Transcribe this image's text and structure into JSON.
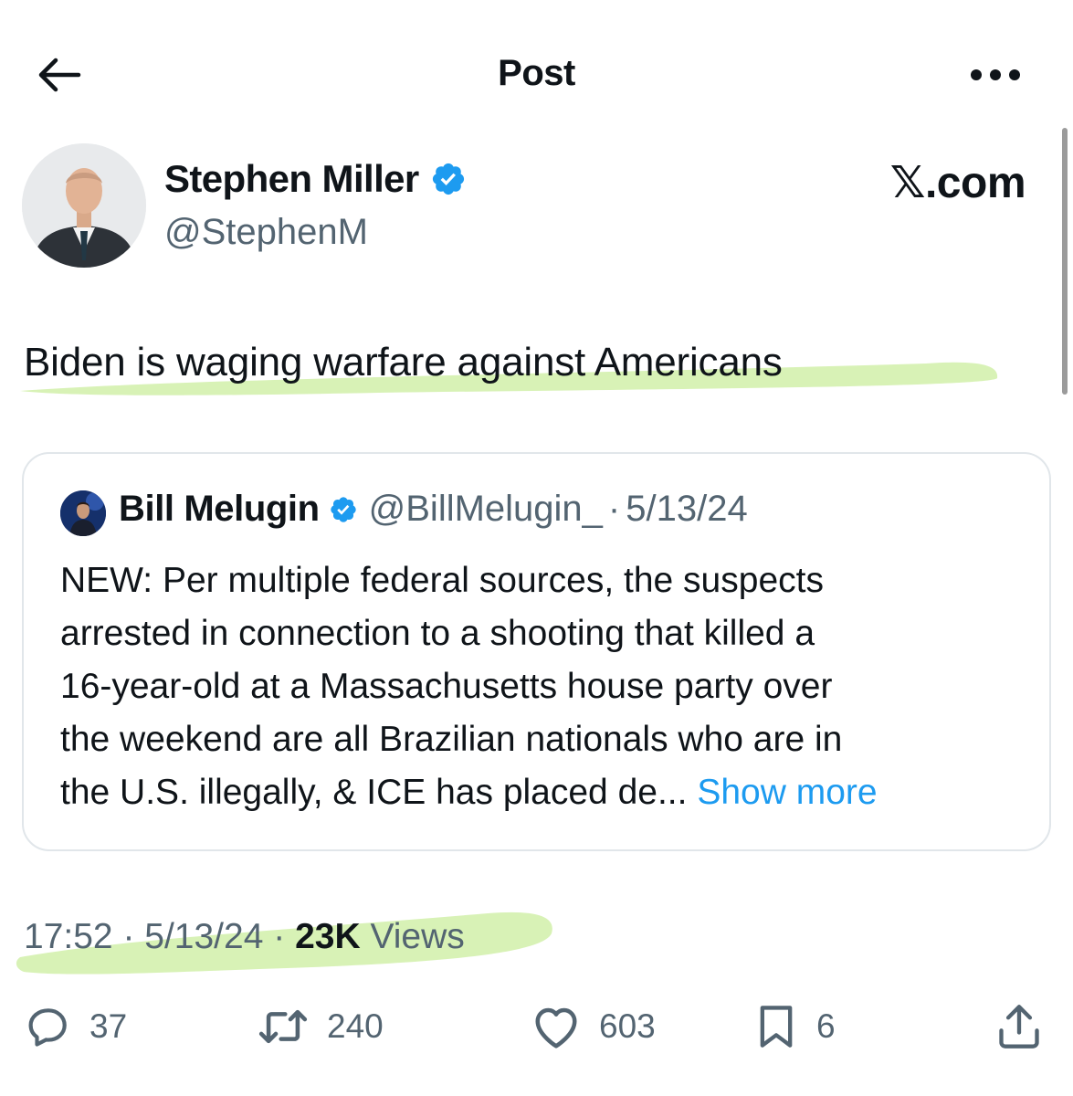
{
  "header": {
    "title": "Post",
    "back_icon": "arrow-left-icon",
    "more_icon": "more-horizontal-icon"
  },
  "post": {
    "author_name": "Stephen Miller",
    "author_handle": "@StephenM",
    "watermark": "𝕏.com",
    "text": "Biden is waging warfare against Americans",
    "highlight_color": "#d8f2b6"
  },
  "quote": {
    "author_name": "Bill Melugin",
    "author_handle": "@BillMelugin_",
    "separator": "·",
    "date": "5/13/24",
    "lines": [
      "NEW: Per multiple federal sources, the suspects",
      "arrested in connection to a shooting that killed a",
      "16-year-old at a Massachusetts house party over",
      "the weekend are all Brazilian nationals who are in",
      "the U.S. illegally, & ICE has placed de..."
    ],
    "show_more": "Show more"
  },
  "meta": {
    "time": "17:52",
    "sep1": " · ",
    "date": "5/13/24",
    "sep2": " · ",
    "views_count": "23K",
    "views_label": " Views"
  },
  "actions": {
    "replies": "37",
    "reposts": "240",
    "likes": "603",
    "bookmarks": "6"
  },
  "colors": {
    "text_primary": "#0f1419",
    "text_secondary": "#536471",
    "accent": "#1d9bf0",
    "verified": "#1d9bf0",
    "border": "#e1e6ea"
  }
}
